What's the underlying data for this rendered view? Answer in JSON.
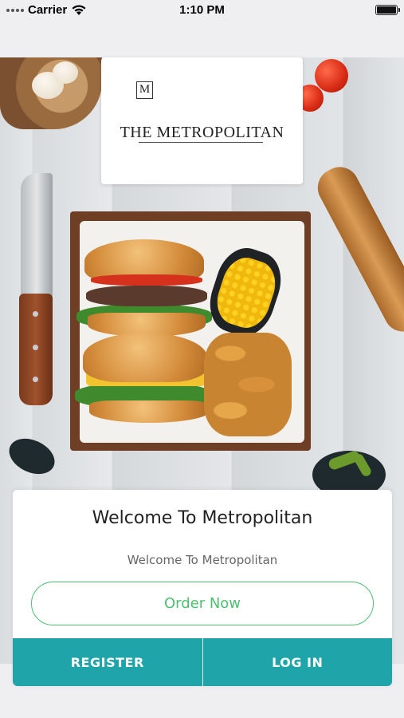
{
  "status_bar": {
    "carrier": "Carrier",
    "time": "1:10 PM"
  },
  "logo": {
    "monogram": "M",
    "brand_name": "THE METROPOLITAN"
  },
  "welcome": {
    "title": "Welcome To Metropolitan",
    "subtitle": "Welcome To Metropolitan",
    "order_button": "Order Now",
    "register_button": "REGISTER",
    "login_button": "LOG IN"
  },
  "colors": {
    "accent_teal": "#1fa5a9",
    "order_green": "#4cc070"
  }
}
